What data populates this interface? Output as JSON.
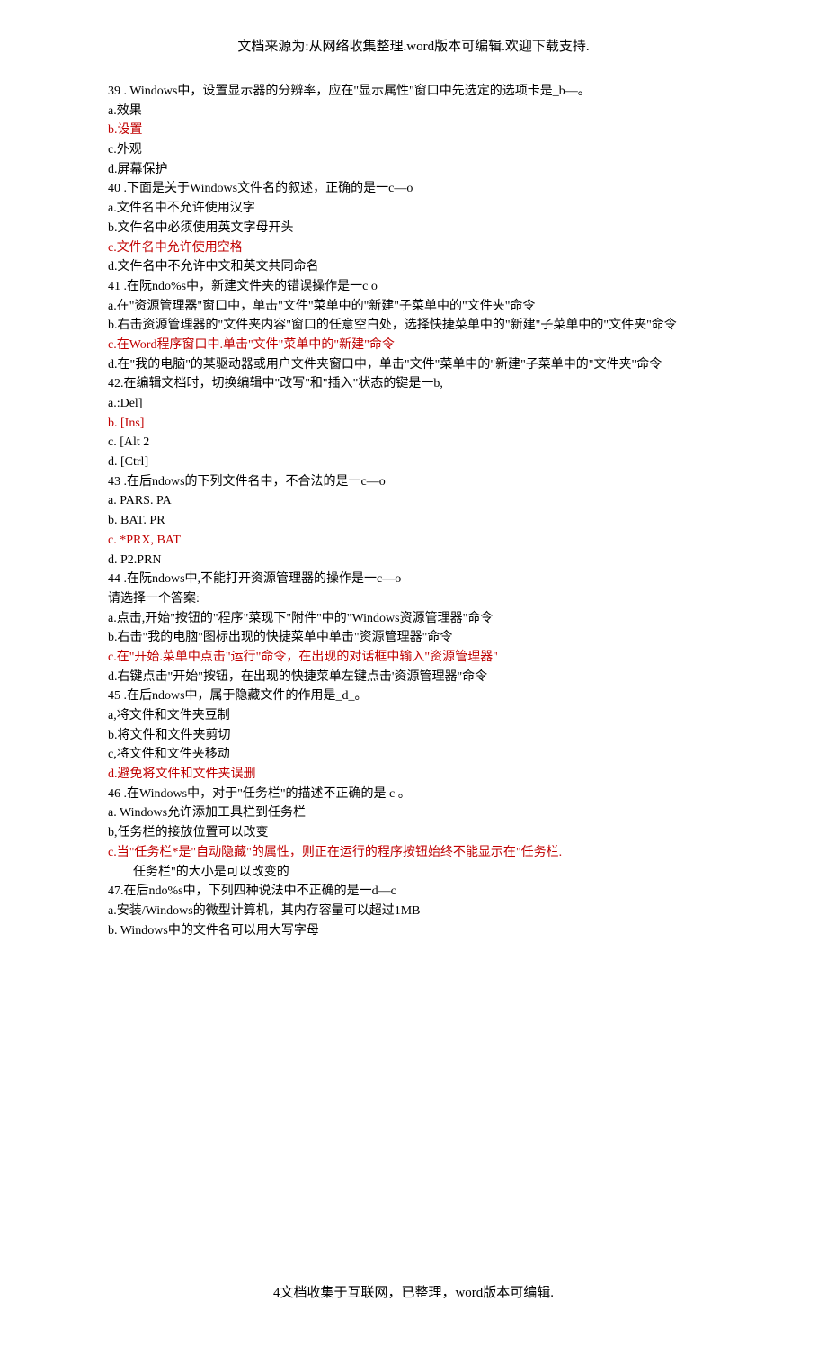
{
  "header": "文档来源为:从网络收集整理.word版本可编辑.欢迎下载支持.",
  "footer": "4文档收集于互联网，已整理，word版本可编辑.",
  "lines": [
    {
      "t": "39 . Windows中，设置显示器的分辨率，应在\"显示属性\"窗口中先选定的选项卡是_b—。",
      "r": false
    },
    {
      "t": "a.效果",
      "r": false
    },
    {
      "t": "b.设置",
      "r": true
    },
    {
      "t": "c.外观",
      "r": false
    },
    {
      "t": "d.屏幕保护",
      "r": false
    },
    {
      "t": "40 .下面是关于Windows文件名的叙述，正确的是一c—o",
      "r": false
    },
    {
      "t": "a.文件名中不允许使用汉字",
      "r": false
    },
    {
      "t": "b.文件名中必须使用英文字母开头",
      "r": false
    },
    {
      "t": "c.文件名中允许使用空格",
      "r": true
    },
    {
      "t": "d.文件名中不允许中文和英文共同命名",
      "r": false
    },
    {
      "t": "41 .在阮ndo%s中，新建文件夹的错误操作是一c o",
      "r": false
    },
    {
      "t": "a.在\"资源管理器\"窗口中，单击\"文件\"菜单中的\"新建\"子菜单中的\"文件夹\"命令",
      "r": false
    },
    {
      "t": "b.右击资源管理器的\"文件夹内容\"窗口的任意空白处，选择快捷菜单中的\"新建\"子菜单中的\"文件夹\"命令",
      "r": false
    },
    {
      "t": "c.在Word程序窗口中.单击\"文件\"菜单中的\"新建\"命令",
      "r": true
    },
    {
      "t": "d.在\"我的电脑\"的某驱动器或用户文件夹窗口中，单击\"文件\"菜单中的\"新建\"子菜单中的\"文件夹\"命令",
      "r": false
    },
    {
      "t": "42.在编辑文档时，切换编辑中\"改写\"和\"插入\"状态的键是一b,",
      "r": false
    },
    {
      "t": "a.:Del]",
      "r": false
    },
    {
      "t": "b. [Ins]",
      "r": true
    },
    {
      "t": "c. [Alt 2",
      "r": false
    },
    {
      "t": "d. [Ctrl]",
      "r": false
    },
    {
      "t": "43 .在后ndows的下列文件名中，不合法的是一c—o",
      "r": false
    },
    {
      "t": "a. PARS. PA",
      "r": false
    },
    {
      "t": "b. BAT. PR",
      "r": false
    },
    {
      "t": "c. *PRX, BAT",
      "r": true
    },
    {
      "t": "d. P2.PRN",
      "r": false
    },
    {
      "t": "44 .在阮ndows中,不能打开资源管理器的操作是一c—o",
      "r": false
    },
    {
      "t": "请选择一个答案:",
      "r": false
    },
    {
      "t": "a.点击,开始\"按钮的\"程序\"菜现下\"附件\"中的\"Windows资源管理器\"命令",
      "r": false
    },
    {
      "t": "b.右击\"我的电脑\"图标出现的快捷菜单中单击\"资源管理器\"命令",
      "r": false
    },
    {
      "t": "c.在\"开始.菜单中点击\"运行\"命令，在出现的对话框中输入\"资源管理器\"",
      "r": true
    },
    {
      "t": "d.右键点击\"开始\"按钮，在出现的快捷菜单左键点击'资源管理器\"命令",
      "r": false
    },
    {
      "t": "45 .在后ndows中，属于隐藏文件的作用是_d_。",
      "r": false
    },
    {
      "t": "a,将文件和文件夹豆制",
      "r": false
    },
    {
      "t": "b.将文件和文件夹剪切",
      "r": false
    },
    {
      "t": "c,将文件和文件夹移动",
      "r": false
    },
    {
      "t": "d.避免将文件和文件夹误删",
      "r": true
    },
    {
      "t": "46 .在Windows中，对于\"任务栏\"的描述不正确的是 c 。",
      "r": false
    },
    {
      "t": "a. Windows允许添加工具栏到任务栏",
      "r": false
    },
    {
      "t": "b,任务栏的接放位置可以改变",
      "r": false
    },
    {
      "t": "c.当\"任务栏*是\"自动隐藏\"的属性，则正在运行的程序按钮始终不能显示在\"任务栏.",
      "r": true
    },
    {
      "t": "任务栏\"的大小是可以改变的",
      "r": false,
      "indent": true
    },
    {
      "t": "47.在后ndo%s中，下列四种说法中不正确的是一d—c",
      "r": false
    },
    {
      "t": "a.安装/Windows的微型计算机，其内存容量可以超过1MB",
      "r": false
    },
    {
      "t": "b. Windows中的文件名可以用大写字母",
      "r": false
    }
  ]
}
